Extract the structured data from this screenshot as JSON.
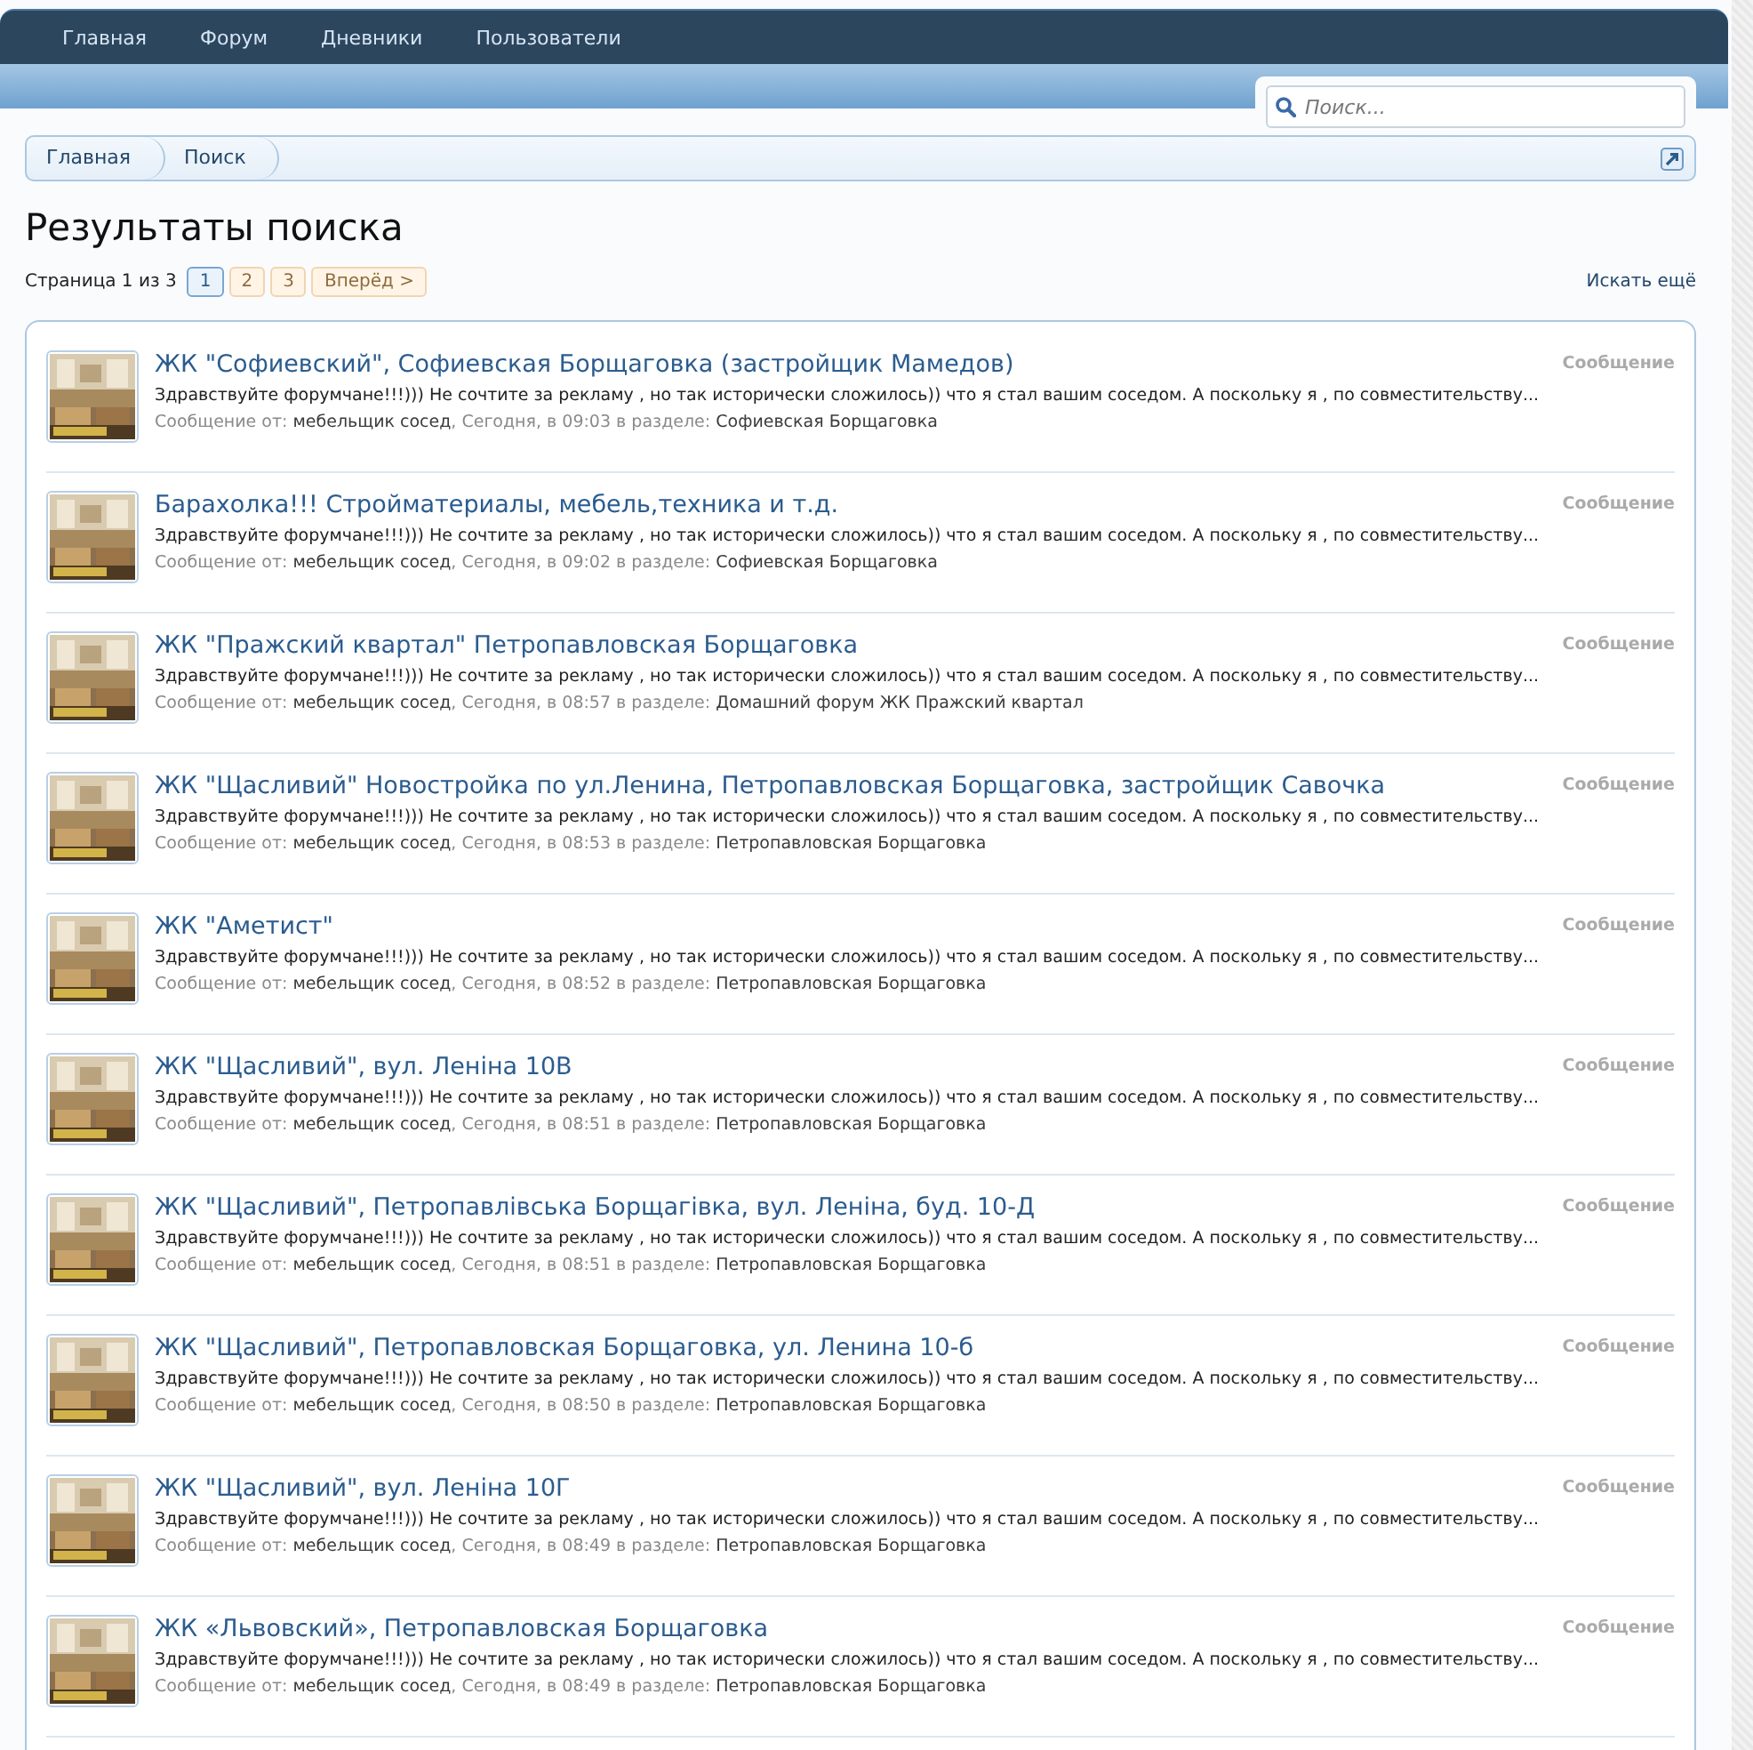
{
  "nav": {
    "items": [
      {
        "label": "Главная"
      },
      {
        "label": "Форум"
      },
      {
        "label": "Дневники"
      },
      {
        "label": "Пользователи"
      }
    ]
  },
  "search": {
    "placeholder": "Поиск..."
  },
  "breadcrumbs": [
    {
      "label": "Главная"
    },
    {
      "label": "Поиск"
    }
  ],
  "heading": "Результаты поиска",
  "pagination": {
    "label": "Страница 1 из 3",
    "pages": [
      {
        "label": "1",
        "selected": true
      },
      {
        "label": "2",
        "selected": false
      },
      {
        "label": "3",
        "selected": false
      }
    ],
    "next": "Вперёд >"
  },
  "search_more": "Искать ещё",
  "results": [
    {
      "title": "ЖК \"Софиевский\", Софиевская Борщаговка (застройщик Мамедов)",
      "snippet": "Здравствуйте форумчане!!!))) Не сочтите за рекламу , но так исторически сложилось)) что я стал вашим соседом. А поскольку я , по совместительству...",
      "prefix": "Сообщение от:",
      "author": "мебельщик сосед",
      "date": ", Сегодня, в 09:03",
      "section_label": "в разделе:",
      "forum": "Софиевская Борщаговка",
      "type": "Сообщение"
    },
    {
      "title": "Барахолка!!! Стройматериалы, мебель,техника и т.д.",
      "snippet": "Здравствуйте форумчане!!!))) Не сочтите за рекламу , но так исторически сложилось)) что я стал вашим соседом. А поскольку я , по совместительству...",
      "prefix": "Сообщение от:",
      "author": "мебельщик сосед",
      "date": ", Сегодня, в 09:02",
      "section_label": "в разделе:",
      "forum": "Софиевская Борщаговка",
      "type": "Сообщение"
    },
    {
      "title": "ЖК \"Пражский квартал\" Петропавловская Борщаговка",
      "snippet": "Здравствуйте форумчане!!!))) Не сочтите за рекламу , но так исторически сложилось)) что я стал вашим соседом. А поскольку я , по совместительству...",
      "prefix": "Сообщение от:",
      "author": "мебельщик сосед",
      "date": ", Сегодня, в 08:57",
      "section_label": "в разделе:",
      "forum": "Домашний форум ЖК Пражский квартал",
      "type": "Сообщение"
    },
    {
      "title": "ЖК \"Щасливий\" Новостройка по ул.Ленина, Петропавловская Борщаговка, застройщик Савочка",
      "snippet": "Здравствуйте форумчане!!!))) Не сочтите за рекламу , но так исторически сложилось)) что я стал вашим соседом. А поскольку я , по совместительству...",
      "prefix": "Сообщение от:",
      "author": "мебельщик сосед",
      "date": ", Сегодня, в 08:53",
      "section_label": "в разделе:",
      "forum": "Петропавловская Борщаговка",
      "type": "Сообщение"
    },
    {
      "title": "ЖК \"Аметист\"",
      "snippet": "Здравствуйте форумчане!!!))) Не сочтите за рекламу , но так исторически сложилось)) что я стал вашим соседом. А поскольку я , по совместительству...",
      "prefix": "Сообщение от:",
      "author": "мебельщик сосед",
      "date": ", Сегодня, в 08:52",
      "section_label": "в разделе:",
      "forum": "Петропавловская Борщаговка",
      "type": "Сообщение"
    },
    {
      "title": "ЖК \"Щасливий\", вул. Леніна 10В",
      "snippet": "Здравствуйте форумчане!!!))) Не сочтите за рекламу , но так исторически сложилось)) что я стал вашим соседом. А поскольку я , по совместительству...",
      "prefix": "Сообщение от:",
      "author": "мебельщик сосед",
      "date": ", Сегодня, в 08:51",
      "section_label": "в разделе:",
      "forum": "Петропавловская Борщаговка",
      "type": "Сообщение"
    },
    {
      "title": "ЖК \"Щасливий\", Петропавлівська Борщагівка, вул. Леніна, буд. 10-Д",
      "snippet": "Здравствуйте форумчане!!!))) Не сочтите за рекламу , но так исторически сложилось)) что я стал вашим соседом. А поскольку я , по совместительству...",
      "prefix": "Сообщение от:",
      "author": "мебельщик сосед",
      "date": ", Сегодня, в 08:51",
      "section_label": "в разделе:",
      "forum": "Петропавловская Борщаговка",
      "type": "Сообщение"
    },
    {
      "title": "ЖК \"Щасливий\", Петропавловская Борщаговка, ул. Ленина 10-б",
      "snippet": "Здравствуйте форумчане!!!))) Не сочтите за рекламу , но так исторически сложилось)) что я стал вашим соседом. А поскольку я , по совместительству...",
      "prefix": "Сообщение от:",
      "author": "мебельщик сосед",
      "date": ", Сегодня, в 08:50",
      "section_label": "в разделе:",
      "forum": "Петропавловская Борщаговка",
      "type": "Сообщение"
    },
    {
      "title": "ЖК \"Щасливий\", вул. Леніна 10Г",
      "snippet": "Здравствуйте форумчане!!!))) Не сочтите за рекламу , но так исторически сложилось)) что я стал вашим соседом. А поскольку я , по совместительству...",
      "prefix": "Сообщение от:",
      "author": "мебельщик сосед",
      "date": ", Сегодня, в 08:49",
      "section_label": "в разделе:",
      "forum": "Петропавловская Борщаговка",
      "type": "Сообщение"
    },
    {
      "title": "ЖК «Львовский», Петропавловская Борщаговка",
      "snippet": "Здравствуйте форумчане!!!))) Не сочтите за рекламу , но так исторически сложилось)) что я стал вашим соседом. А поскольку я , по совместительству...",
      "prefix": "Сообщение от:",
      "author": "мебельщик сосед",
      "date": ", Сегодня, в 08:49",
      "section_label": "в разделе:",
      "forum": "Петропавловская Борщаговка",
      "type": "Сообщение"
    }
  ]
}
